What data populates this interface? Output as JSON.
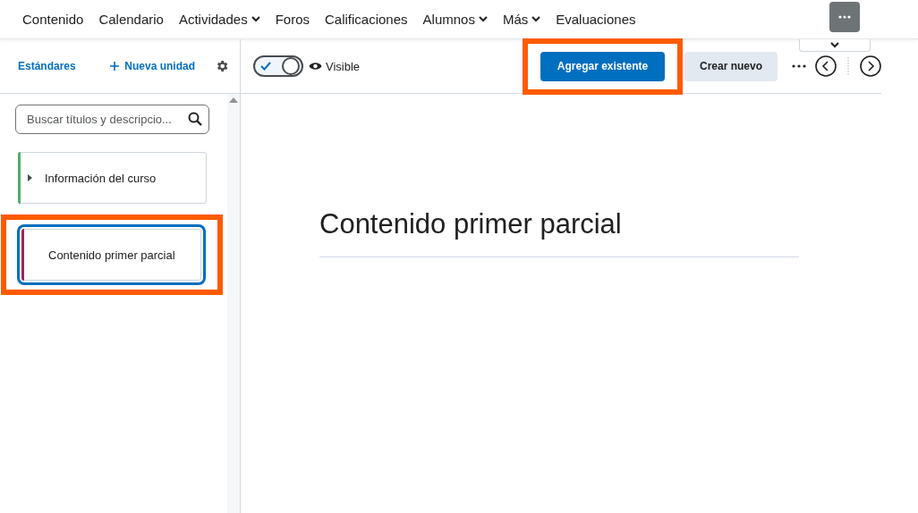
{
  "nav": [
    {
      "label": "Contenido",
      "dropdown": false
    },
    {
      "label": "Calendario",
      "dropdown": false
    },
    {
      "label": "Actividades",
      "dropdown": true
    },
    {
      "label": "Foros",
      "dropdown": false
    },
    {
      "label": "Calificaciones",
      "dropdown": false
    },
    {
      "label": "Alumnos",
      "dropdown": true
    },
    {
      "label": "Más",
      "dropdown": true
    },
    {
      "label": "Evaluaciones",
      "dropdown": false
    }
  ],
  "sidebar": {
    "standards_link": "Estándares",
    "new_unit": "Nueva unidad",
    "search": {
      "placeholder": "Buscar títulos y descripcio..."
    },
    "units": [
      {
        "title": "Información del curso",
        "color": "#4caf6a",
        "selected": false,
        "expandable": true,
        "highlighted": false
      },
      {
        "title": "Contenido primer parcial",
        "color": "#a3215f",
        "selected": true,
        "expandable": false,
        "highlighted": true
      }
    ]
  },
  "toolbar": {
    "visible_toggle": {
      "on": true,
      "label": "Visible"
    },
    "add_existing": {
      "label": "Agregar existente",
      "highlighted": true
    },
    "create_new": "Crear nuevo"
  },
  "content": {
    "title": "Contenido primer parcial"
  }
}
